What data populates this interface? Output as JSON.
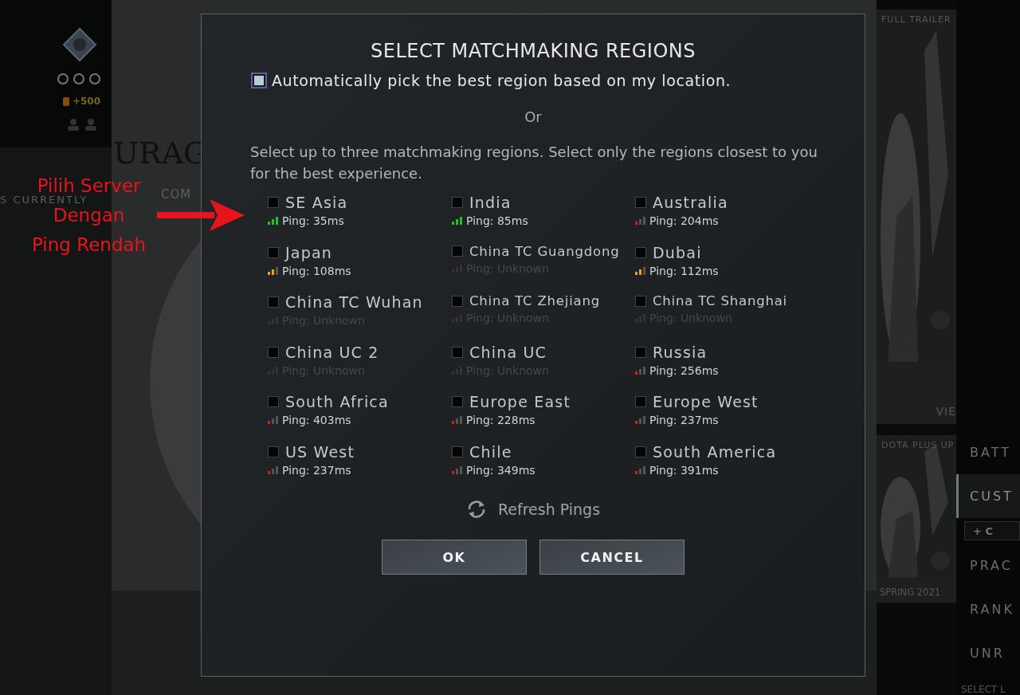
{
  "background": {
    "left_panel": {
      "reward": "+500",
      "status": "S CURRENTLY"
    },
    "art_texts": [
      "URAG",
      "COM"
    ],
    "side_tiles": [
      {
        "caption_top": "FULL TRAILER",
        "caption_bottom": "VIE"
      },
      {
        "caption_top": "DOTA PLUS UP",
        "caption_bottom": "SPRING 2021"
      }
    ],
    "nav": [
      {
        "label": "BATT",
        "selected": false
      },
      {
        "label": "CUST",
        "selected": true
      },
      {
        "label": "+ C",
        "kind": "button"
      },
      {
        "label": "PRAC",
        "selected": false
      },
      {
        "label": "RANK",
        "selected": false
      },
      {
        "label": "UNR",
        "selected": false
      }
    ],
    "footer": "SELECT L"
  },
  "annotation": {
    "text": [
      "Pilih Server",
      "Dengan",
      "Ping Rendah"
    ]
  },
  "dialog": {
    "title": "SELECT MATCHMAKING REGIONS",
    "auto_pick": {
      "label": "Automatically pick the best region based on my location.",
      "checked": true
    },
    "or": "Or",
    "instructions": "Select up to three matchmaking regions. Select only the regions closest to you for the best experience.",
    "regions": [
      {
        "name": "SE Asia",
        "checked": false,
        "ping": "Ping: 35ms",
        "kind": "good"
      },
      {
        "name": "India",
        "checked": false,
        "ping": "Ping: 85ms",
        "kind": "good"
      },
      {
        "name": "Australia",
        "checked": false,
        "ping": "Ping: 204ms",
        "kind": "poor"
      },
      {
        "name": "Japan",
        "checked": false,
        "ping": "Ping: 108ms",
        "kind": "fair"
      },
      {
        "name": "China TC Guangdong",
        "checked": false,
        "ping": "Ping: Unknown",
        "kind": "unknown"
      },
      {
        "name": "Dubai",
        "checked": false,
        "ping": "Ping: 112ms",
        "kind": "fair"
      },
      {
        "name": "China TC Wuhan",
        "checked": false,
        "ping": "Ping: Unknown",
        "kind": "unknown"
      },
      {
        "name": "China TC Zhejiang",
        "checked": false,
        "ping": "Ping: Unknown",
        "kind": "unknown"
      },
      {
        "name": "China TC Shanghai",
        "checked": false,
        "ping": "Ping: Unknown",
        "kind": "unknown"
      },
      {
        "name": "China UC 2",
        "checked": false,
        "ping": "Ping: Unknown",
        "kind": "unknown"
      },
      {
        "name": "China UC",
        "checked": false,
        "ping": "Ping: Unknown",
        "kind": "unknown"
      },
      {
        "name": "Russia",
        "checked": false,
        "ping": "Ping: 256ms",
        "kind": "poor"
      },
      {
        "name": "South Africa",
        "checked": false,
        "ping": "Ping: 403ms",
        "kind": "poor"
      },
      {
        "name": "Europe East",
        "checked": false,
        "ping": "Ping: 228ms",
        "kind": "poor"
      },
      {
        "name": "Europe West",
        "checked": false,
        "ping": "Ping: 237ms",
        "kind": "poor"
      },
      {
        "name": "US West",
        "checked": false,
        "ping": "Ping: 237ms",
        "kind": "poor"
      },
      {
        "name": "Chile",
        "checked": false,
        "ping": "Ping: 349ms",
        "kind": "poor"
      },
      {
        "name": "South America",
        "checked": false,
        "ping": "Ping: 391ms",
        "kind": "poor"
      }
    ],
    "refresh": "Refresh Pings",
    "buttons": [
      "OK",
      "CANCEL"
    ]
  }
}
